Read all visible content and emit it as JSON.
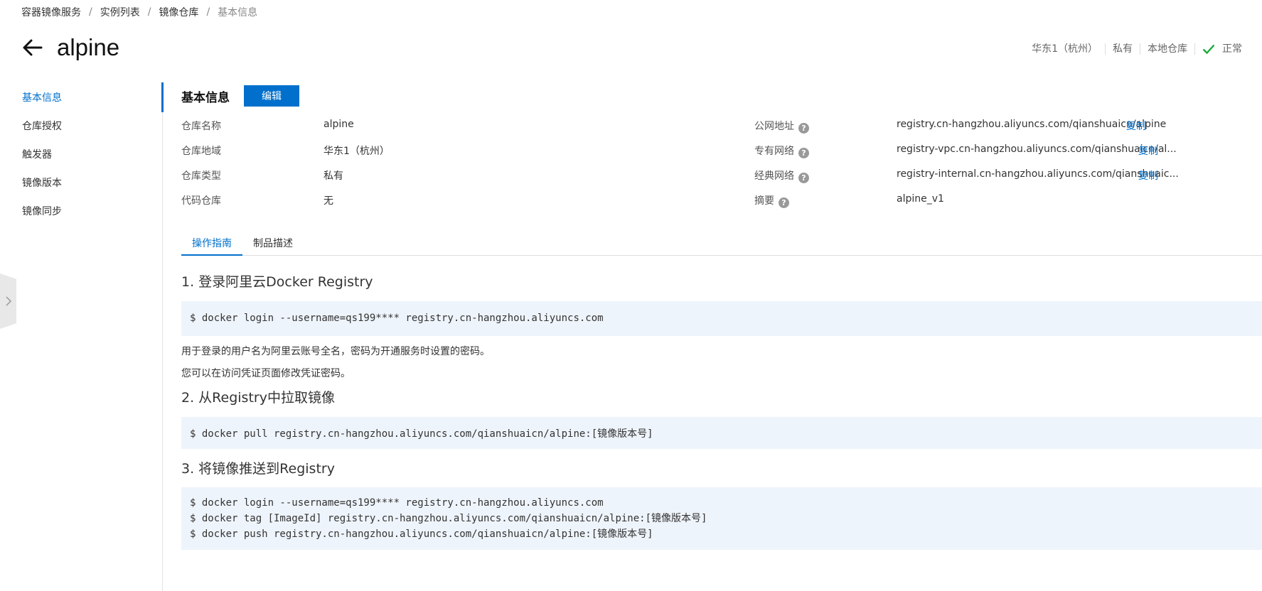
{
  "breadcrumb": [
    "容器镜像服务",
    "实例列表",
    "镜像仓库",
    "基本信息"
  ],
  "breadcrumb_sep": "/",
  "header": {
    "title": "alpine"
  },
  "status_bar": {
    "region": "华东1（杭州）",
    "visibility": "私有",
    "repo_source": "本地仓库",
    "status": "正常"
  },
  "sidenav": {
    "items": [
      "基本信息",
      "仓库授权",
      "触发器",
      "镜像版本",
      "镜像同步"
    ]
  },
  "section": {
    "title": "基本信息",
    "edit_label": "编辑"
  },
  "info_left": [
    {
      "label": "仓库名称",
      "value": "alpine"
    },
    {
      "label": "仓库地域",
      "value": "华东1（杭州）"
    },
    {
      "label": "仓库类型",
      "value": "私有"
    },
    {
      "label": "代码仓库",
      "value": "无"
    }
  ],
  "info_right": [
    {
      "label": "公网地址",
      "value": "registry.cn-hangzhou.aliyuncs.com/qianshuaicn/alpine",
      "copy": "复制"
    },
    {
      "label": "专有网络",
      "value": "registry-vpc.cn-hangzhou.aliyuncs.com/qianshuaicn/al...",
      "copy": "复制"
    },
    {
      "label": "经典网络",
      "value": "registry-internal.cn-hangzhou.aliyuncs.com/qianshuaic...",
      "copy": "复制"
    },
    {
      "label": "摘要",
      "value": "alpine_v1"
    }
  ],
  "help_glyph": "?",
  "tabs": [
    "操作指南",
    "制品描述"
  ],
  "guide": {
    "step1_title": "1. 登录阿里云Docker Registry",
    "step1_code": "$ docker login --username=qs199**** registry.cn-hangzhou.aliyuncs.com",
    "step1_note1": "用于登录的用户名为阿里云账号全名，密码为开通服务时设置的密码。",
    "step1_note2": "您可以在访问凭证页面修改凭证密码。",
    "step2_title": "2. 从Registry中拉取镜像",
    "step2_code": "$ docker pull registry.cn-hangzhou.aliyuncs.com/qianshuaicn/alpine:[镜像版本号]",
    "step3_title": "3. 将镜像推送到Registry",
    "step3_code": "$ docker login --username=qs199**** registry.cn-hangzhou.aliyuncs.com\n$ docker tag [ImageId] registry.cn-hangzhou.aliyuncs.com/qianshuaicn/alpine:[镜像版本号]\n$ docker push registry.cn-hangzhou.aliyuncs.com/qianshuaicn/alpine:[镜像版本号]"
  },
  "colors": {
    "accent": "#0070cc",
    "status_ok": "#1aab3c",
    "code_bg": "#eef4fb"
  }
}
